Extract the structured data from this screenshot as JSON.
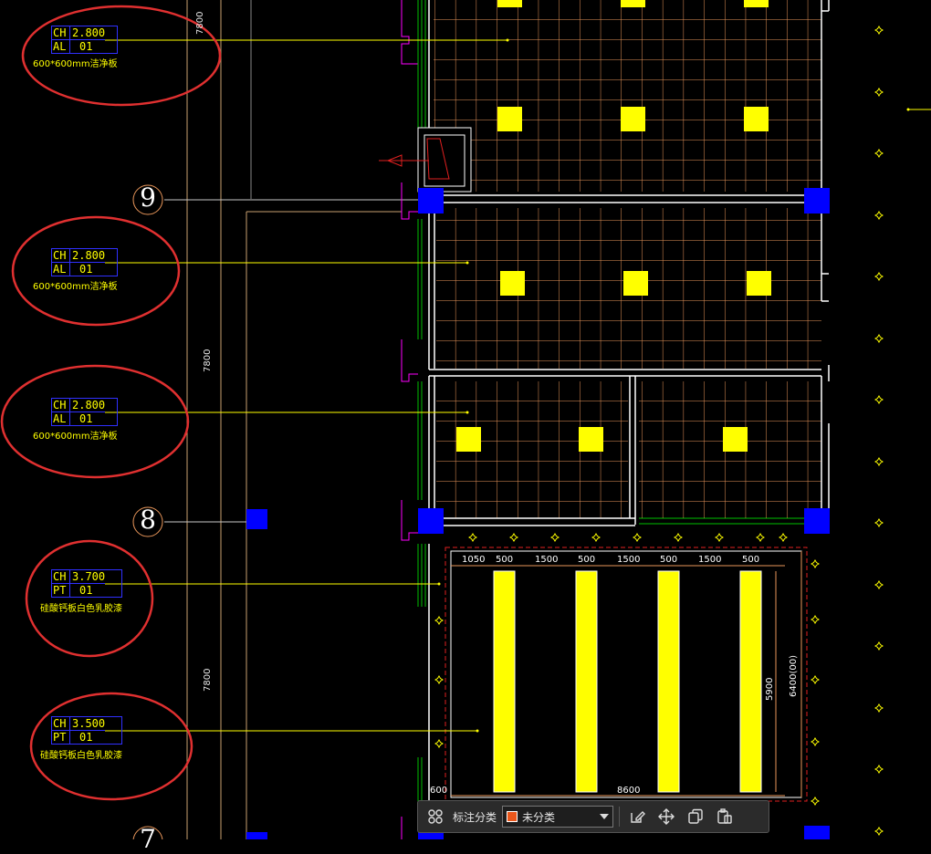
{
  "annotations": [
    {
      "ch_label": "CH",
      "ch_value": "2.800",
      "code_label": "AL",
      "code_value": "01",
      "material": "600*600mm洁净板"
    },
    {
      "ch_label": "CH",
      "ch_value": "2.800",
      "code_label": "AL",
      "code_value": "01",
      "material": "600*600mm洁净板"
    },
    {
      "ch_label": "CH",
      "ch_value": "2.800",
      "code_label": "AL",
      "code_value": "01",
      "material": "600*600mm洁净板"
    },
    {
      "ch_label": "CH",
      "ch_value": "3.700",
      "code_label": "PT",
      "code_value": "01",
      "material": "硅酸钙板白色乳胶漆"
    },
    {
      "ch_label": "CH",
      "ch_value": "3.500",
      "code_label": "PT",
      "code_value": "01",
      "material": "硅酸钙板白色乳胶漆"
    }
  ],
  "grid_axes": [
    "9",
    "8",
    "7"
  ],
  "bay_dimensions": [
    "7800",
    "7800",
    "7800"
  ],
  "lighting_dims": {
    "top": [
      "1050",
      "500",
      "1500",
      "500",
      "1500",
      "500",
      "1500",
      "500"
    ],
    "bottom_total": "8600",
    "left_offset": "600",
    "height": "5900",
    "outer": "6400(00)"
  },
  "toolbar": {
    "label": "标注分类",
    "category": "未分类",
    "category_color": "#e8561b",
    "icons": [
      "grid-icon",
      "edit-icon",
      "move-icon",
      "copy-icon",
      "paste-icon"
    ]
  },
  "colors": {
    "background": "#000000",
    "ceiling_grid": "#e8965a",
    "light_panel": "#ffff00",
    "column": "#0000ff",
    "highlight_circle": "#e03030",
    "wall": "#ffffff"
  }
}
